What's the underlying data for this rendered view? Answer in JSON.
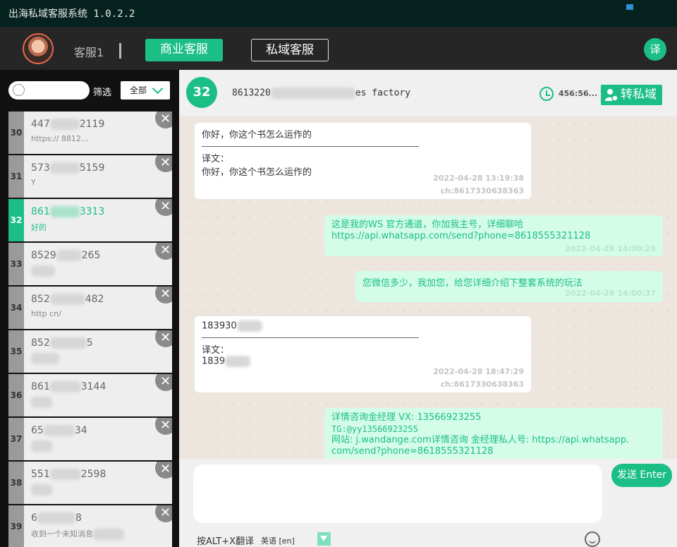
{
  "app": {
    "title": "出海私域客服系统 1.0.2.2"
  },
  "header": {
    "agent_name": "客服1",
    "tabs": [
      {
        "label": "商业客服",
        "active": true
      },
      {
        "label": "私域客服",
        "active": false
      }
    ],
    "translate_label": "译"
  },
  "sidebar": {
    "search_placeholder": "",
    "filter_label": "筛选",
    "filter_value": "全部",
    "contacts": [
      {
        "index": "30",
        "phone_a": "447",
        "phone_b": "2119",
        "preview": "https://  8812...",
        "active": false
      },
      {
        "index": "31",
        "phone_a": "573",
        "phone_b": "5159",
        "preview": "Y",
        "active": false
      },
      {
        "index": "32",
        "phone_a": "861",
        "phone_b": "3313",
        "preview": "好的",
        "active": true
      },
      {
        "index": "33",
        "phone_a": "8529",
        "phone_b": "265",
        "preview": "",
        "active": false
      },
      {
        "index": "34",
        "phone_a": "852",
        "phone_b": "482",
        "preview": "http  cn/",
        "active": false
      },
      {
        "index": "35",
        "phone_a": "852",
        "phone_b": "5",
        "preview": "",
        "active": false
      },
      {
        "index": "36",
        "phone_a": "861",
        "phone_b": "3144",
        "preview": "",
        "active": false
      },
      {
        "index": "37",
        "phone_a": "65",
        "phone_b": "34",
        "preview": "",
        "active": false
      },
      {
        "index": "38",
        "phone_a": "551",
        "phone_b": "2598",
        "preview": "",
        "active": false
      },
      {
        "index": "39",
        "phone_a": "6",
        "phone_b": "8",
        "preview": "收到一个未知消息",
        "active": false
      }
    ]
  },
  "chat": {
    "badge": "32",
    "title_a": "8613220",
    "title_b": "es  factory",
    "timer": "456:56...",
    "transfer_label": "转私域",
    "messages": [
      {
        "dir": "in",
        "text": "你好，你这个书怎么运作的",
        "translation_label": "译文：",
        "translation": "你好，你这个书怎么运作的",
        "time": "2022-04-28 13:19:38",
        "channel": "ch:8617330638363"
      },
      {
        "dir": "out",
        "text": "这是我的WS 官方通道，你加我主号，详细聊哈 https://api.whatsapp.com/send?phone=8618555321128",
        "time": "2022-04-28 14:00:25"
      },
      {
        "dir": "out",
        "text": "您微信多少，我加您，给您详细介绍下整套系统的玩法",
        "time": "2022-04-28 14:00:37"
      },
      {
        "dir": "in",
        "text": "183930",
        "translation_label": "译文：",
        "translation": "1839",
        "time": "2022-04-28 18:47:29",
        "channel": "ch:8617330638363"
      },
      {
        "dir": "out",
        "line1": "详情咨询金经理 VX: 13566923255",
        "line2": "TG:@yy13566923255",
        "line3": "网站: j.wandange.com详情咨询 金经理私人号: https://api.whatsapp.",
        "line4": "com/send?phone=8618555321128"
      }
    ]
  },
  "composer": {
    "input_value": "",
    "send_label": "发送 Enter",
    "hint": "按ALT+X翻译",
    "language": "英语 [en]"
  },
  "colors": {
    "accent": "#1bbf86",
    "outgoing_bg": "#d4fce9",
    "chat_bg": "#ece6df"
  }
}
